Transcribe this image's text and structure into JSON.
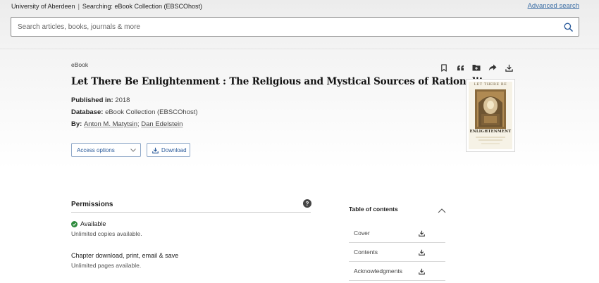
{
  "topbar": {
    "institution": "University of Aberdeen",
    "searching_label": "Searching:",
    "collection": "eBook Collection (EBSCOhost)",
    "advanced_search": "Advanced search"
  },
  "search": {
    "placeholder": "Search articles, books, journals & more"
  },
  "record": {
    "type": "eBook",
    "title": "Let There Be Enlightenment : The Religious and Mystical Sources of Rationality",
    "published_label": "Published in:",
    "published_value": "2018",
    "database_label": "Database:",
    "database_value": "eBook Collection (EBSCOhost)",
    "by_label": "By:",
    "authors": [
      "Anton M. Matytsin",
      "Dan Edelstein"
    ],
    "author_sep": ";"
  },
  "actions": {
    "access_options": "Access options",
    "download": "Download",
    "icons": [
      "bookmark-icon",
      "cite-icon",
      "add-to-folder-icon",
      "share-icon",
      "download-icon"
    ]
  },
  "cover": {
    "line1": "LET THERE BE",
    "line2": "ENLIGHTENMENT"
  },
  "permissions": {
    "title": "Permissions",
    "help": "?",
    "available": "Available",
    "copies": "Unlimited copies available.",
    "chapter_label": "Chapter download, print, email & save",
    "pages": "Unlimited pages available."
  },
  "toc": {
    "title": "Table of contents",
    "items": [
      "Cover",
      "Contents",
      "Acknowledgments"
    ]
  },
  "colors": {
    "link": "#3b6ea5",
    "button_text": "#2a5a9a",
    "success": "#2e8b3d"
  }
}
